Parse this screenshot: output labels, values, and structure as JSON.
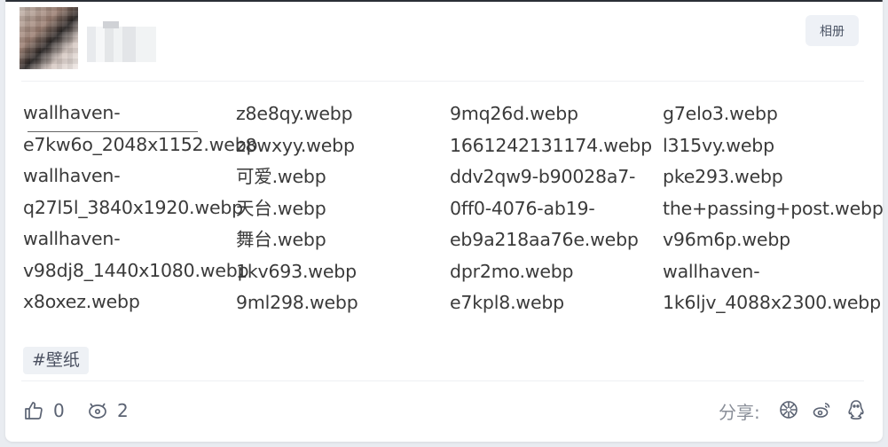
{
  "header": {
    "album_label": "相册"
  },
  "files": {
    "col1": [
      "wallhaven-",
      "e7kw6o_2048x1152.webp",
      "wallhaven-",
      "q27l5l_3840x1920.webp",
      "wallhaven-",
      "v98dj8_1440x1080.webp",
      "x8oxez.webp"
    ],
    "col2": [
      "z8e8qy.webp",
      "z8wxyy.webp",
      "可爱.webp",
      "天台.webp",
      "舞台.webp",
      "1kv693.webp",
      "9ml298.webp"
    ],
    "col3": [
      "9mq26d.webp",
      "1661242131174.webp",
      "ddv2qw9-b90028a7-",
      "0ff0-4076-ab19-",
      "eb9a218aa76e.webp",
      "dpr2mo.webp",
      "e7kpl8.webp"
    ],
    "col4": [
      "g7elo3.webp",
      "l315vy.webp",
      "pke293.webp",
      "the+passing+post.webp",
      "v96m6p.webp",
      "wallhaven-",
      "1k6ljv_4088x2300.webp"
    ]
  },
  "tag": "#壁纸",
  "footer": {
    "like_count": "0",
    "comment_count": "2",
    "share_label": "分享:"
  },
  "icons": {
    "like": "thumbs-up-icon",
    "comment": "comment-icon",
    "share1": "wechat-moments-icon",
    "share2": "weibo-icon",
    "share3": "qq-icon"
  }
}
